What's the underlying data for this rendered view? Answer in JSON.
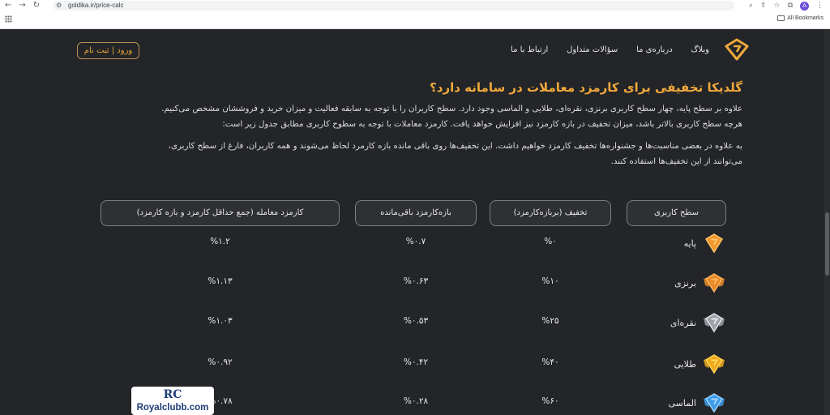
{
  "browser": {
    "url": "goldika.ir/price-calc",
    "all_bookmarks": "All Bookmarks",
    "avatar_letter": "A"
  },
  "nav": {
    "items": [
      "وبلاگ",
      "درباره‌ی ما",
      "سؤالات متداول",
      "ارتباط با ما"
    ],
    "login": "ورود | ثبت نام"
  },
  "content": {
    "heading": "گلدیکا تخفیفی برای کارمزد معاملات در سامانه دارد؟",
    "para1_line1": "علاوه بر سطح پایه، چهار سطح کاربری برنزی، نقره‌ای، طلایی و الماسی وجود دارد. سطح کاربران را با توجه به سابقه فعالیت و میزان خرید و فروششان مشخص می‌کنیم.",
    "para1_line2": "هرچه سطح کاربری بالاتر باشد، میزان تخفیف در بازه کارمزد نیز افزایش خواهد یافت. کارمزد معاملات با توجه به سطوح کاربری مطابق جدول زیر است:",
    "para2_line1": "به علاوه در بعضی مناسبت‌ها و جشنواره‌ها تخفیف کارمزد خواهیم داشت. این تخفیف‌ها روی باقی مانده بازه کارمرد لحاظ می‌شوند و همه کاربران، فارغ از سطح کاربری،",
    "para2_line2": "می‌توانند از این تخفیف‌ها استفاده کنند."
  },
  "table": {
    "headers": {
      "level": "سطح کاربری",
      "discount": "تخفیف (بربازه‌کارمزد)",
      "remaining": "بازه‌کارمزد باقی‌مانده",
      "commission": "کارمزد معامله (جمع حداقل کارمزد و بازه کارمزد)"
    },
    "rows": [
      {
        "level": "پایه",
        "discount": "%۰",
        "remaining": "%۰.۷",
        "commission": "%۱.۲",
        "badge_color": "#f0962e",
        "badge_light": "#ffc46b"
      },
      {
        "level": "برنزی",
        "discount": "%۱۰",
        "remaining": "%۰.۶۳",
        "commission": "%۱.۱۳",
        "badge_color": "#e8892a",
        "badge_light": "#ffb45c"
      },
      {
        "level": "نقره‌ای",
        "discount": "%۲۵",
        "remaining": "%۰.۵۳",
        "commission": "%۱.۰۳",
        "badge_color": "#9ea2a8",
        "badge_light": "#e2e5e9"
      },
      {
        "level": "طلایی",
        "discount": "%۴۰",
        "remaining": "%۰.۴۲",
        "commission": "%۰.۹۲",
        "badge_color": "#f0a91e",
        "badge_light": "#ffd659"
      },
      {
        "level": "الماسی",
        "discount": "%۶۰",
        "remaining": "%۰.۲۸",
        "commission": "%۰.۷۸",
        "badge_color": "#3c9be8",
        "badge_light": "#9fd4ff"
      }
    ]
  },
  "watermark": {
    "mark": "RC",
    "name": "Royalclubb.com"
  },
  "colors": {
    "accent": "#f2a93b",
    "background": "#232528"
  }
}
